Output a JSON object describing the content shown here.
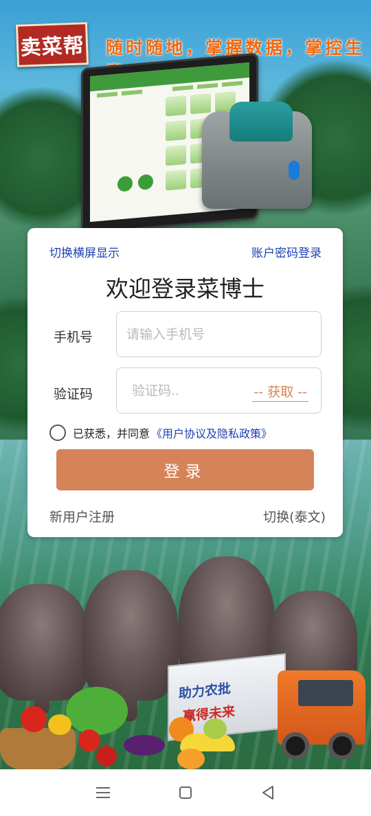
{
  "header": {
    "logo_text": "卖菜帮",
    "slogan": "随时随地，掌握数据，掌控生意"
  },
  "card": {
    "switch_landscape": "切换横屏显示",
    "account_login": "账户密码登录",
    "title": "欢迎登录菜博士",
    "phone_label": "手机号",
    "phone_placeholder": "请输入手机号",
    "code_label": "验证码",
    "code_placeholder": "验证码..",
    "get_code": "获取",
    "agree_text": "已获悉，并同意",
    "agree_link": "《用户协议及隐私政策》",
    "login_button": "登录",
    "register": "新用户注册",
    "switch_language": "切换(泰文)"
  },
  "truck": {
    "line1": "助力农批",
    "line2": "赢得未来"
  },
  "navbar": {
    "icons": [
      "menu-icon",
      "home-icon",
      "back-icon"
    ]
  },
  "colors": {
    "accent": "#d6835a",
    "link": "#1d3fb0",
    "slogan": "#f06a14",
    "logo_red": "#b22a22"
  }
}
